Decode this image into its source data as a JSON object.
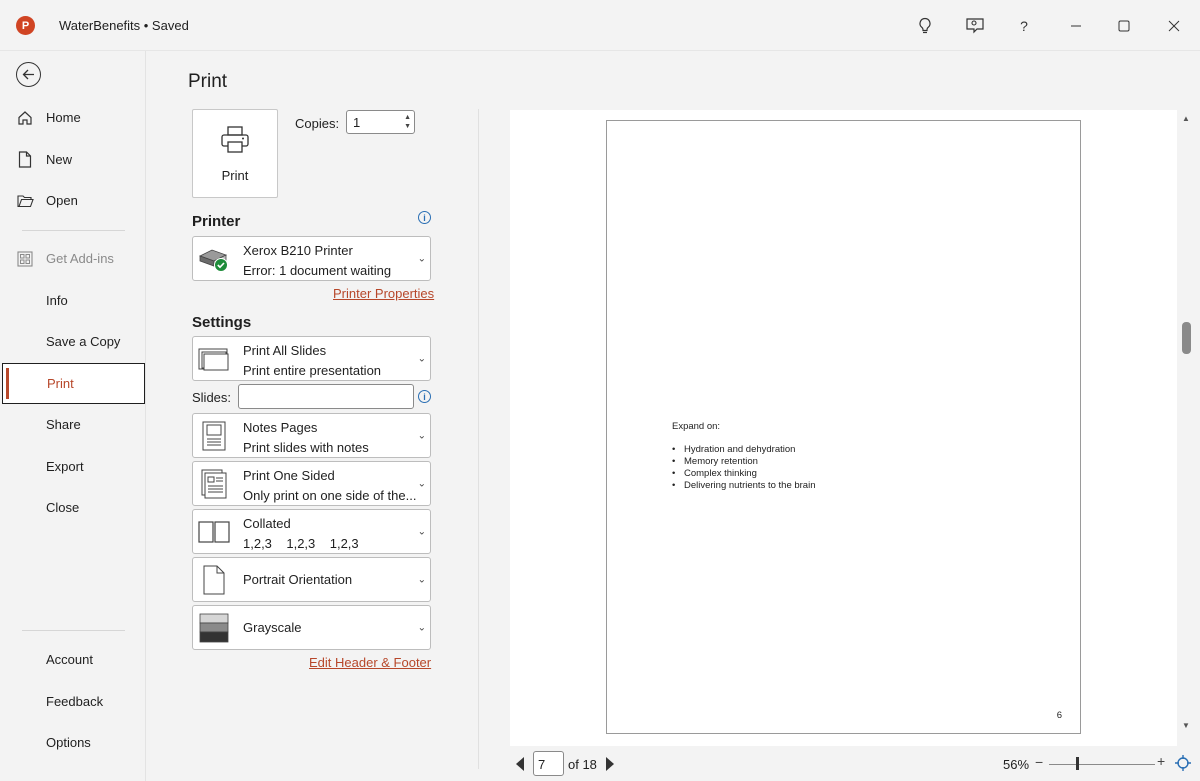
{
  "titlebar": {
    "app_icon_letter": "P",
    "doc_title": "WaterBenefits • Saved",
    "icons": [
      "lightbulb-icon",
      "coauthor-icon",
      "help-icon",
      "minimize-icon",
      "maximize-icon",
      "close-icon"
    ],
    "help_glyph": "?"
  },
  "nav": {
    "back_icon": "back-arrow-icon",
    "items": [
      {
        "label": "Home",
        "icon": "home-icon"
      },
      {
        "label": "New",
        "icon": "new-document-icon"
      },
      {
        "label": "Open",
        "icon": "folder-open-icon"
      },
      {
        "label": "Get Add-ins",
        "icon": "addins-grid-icon",
        "disabled": true
      },
      {
        "label": "Info"
      },
      {
        "label": "Save a Copy"
      },
      {
        "label": "Print",
        "active": true
      },
      {
        "label": "Share"
      },
      {
        "label": "Export"
      },
      {
        "label": "Close"
      },
      {
        "label": "Account"
      },
      {
        "label": "Feedback"
      },
      {
        "label": "Options"
      }
    ]
  },
  "print": {
    "page_title": "Print",
    "print_button_label": "Print",
    "copies_label": "Copies:",
    "copies_value": "1",
    "printer_heading": "Printer",
    "printer_name": "Xerox B210 Printer",
    "printer_status": "Error: 1 document waiting",
    "printer_properties_link": "Printer Properties",
    "settings_heading": "Settings",
    "slides_label": "Slides:",
    "slides_value": "",
    "settings": [
      {
        "line1": "Print All Slides",
        "line2": "Print entire presentation",
        "icon": "print-all-slides-icon"
      },
      {
        "line1": "Notes Pages",
        "line2": "Print slides with notes",
        "icon": "notes-pages-icon"
      },
      {
        "line1": "Print One Sided",
        "line2": "Only print on one side of the...",
        "icon": "one-sided-icon"
      },
      {
        "line1": "Collated",
        "line2": "1,2,3    1,2,3    1,2,3",
        "icon": "collated-icon"
      },
      {
        "line1": "Portrait Orientation",
        "icon": "portrait-orientation-icon"
      },
      {
        "line1": "Grayscale",
        "icon": "grayscale-icon"
      }
    ],
    "edit_header_footer_link": "Edit Header & Footer"
  },
  "preview": {
    "notes_title": "Expand on:",
    "notes_bullets": [
      "Hydration and dehydration",
      "Memory retention",
      "Complex thinking",
      "Delivering nutrients to the brain"
    ],
    "page_number": "6",
    "current_page": "7",
    "total_pages_text": "of 18",
    "zoom_percent": "56%",
    "zoom_minus": "−",
    "zoom_plus": "+",
    "scroll_position": 0.35
  },
  "colors": {
    "accent": "#b7472a",
    "app_icon": "#d04423",
    "info": "#2a6fb4",
    "check_green": "#1e8c3a"
  }
}
